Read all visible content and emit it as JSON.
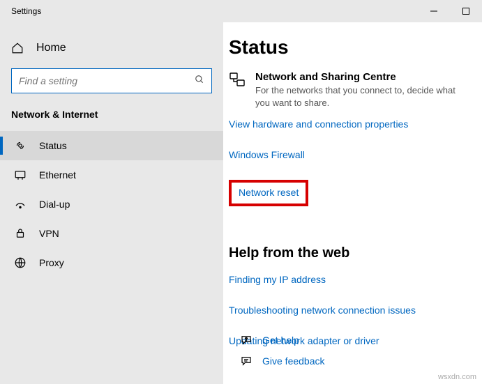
{
  "titlebar": {
    "title": "Settings"
  },
  "sidebar": {
    "home": "Home",
    "search_placeholder": "Find a setting",
    "section": "Network & Internet",
    "items": [
      {
        "label": "Status"
      },
      {
        "label": "Ethernet"
      },
      {
        "label": "Dial-up"
      },
      {
        "label": "VPN"
      },
      {
        "label": "Proxy"
      }
    ]
  },
  "main": {
    "title": "Status",
    "sharing_heading": "Network and Sharing Centre",
    "sharing_desc": "For the networks that you connect to, decide what you want to share.",
    "links": {
      "view_hw": "View hardware and connection properties",
      "windows_firewall": "Windows Firewall",
      "network_reset": "Network reset"
    },
    "help_heading": "Help from the web",
    "help_links": {
      "ip": "Finding my IP address",
      "troubleshoot": "Troubleshooting network connection issues",
      "adapter": "Updating network adapter or driver"
    },
    "footer": {
      "get_help": "Get help",
      "give_feedback": "Give feedback"
    }
  },
  "watermark": "wsxdn.com"
}
